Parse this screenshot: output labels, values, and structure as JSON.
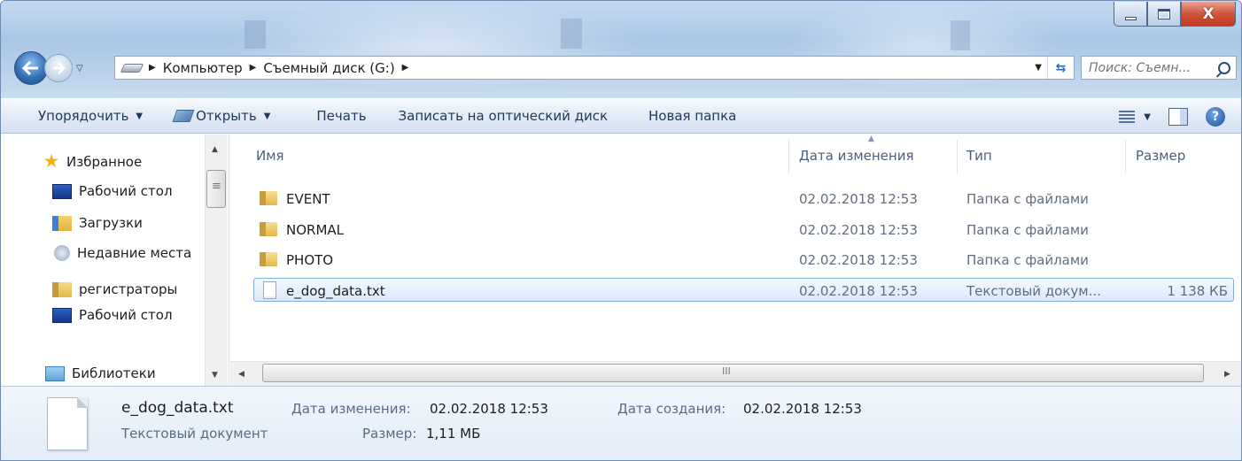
{
  "window": {
    "caption_buttons": [
      "minimize-icon",
      "maximize-icon",
      "close-icon"
    ],
    "close_glyph": "X"
  },
  "address_bar": {
    "crumbs": [
      "Компьютер",
      "Съемный диск (G:)"
    ],
    "search_placeholder": "Поиск: Съемн..."
  },
  "command_bar": {
    "organize": "Упорядочить",
    "open": "Открыть",
    "print": "Печать",
    "burn": "Записать на оптический диск",
    "new_folder": "Новая папка",
    "help_glyph": "?"
  },
  "nav_pane": {
    "favorites": "Избранное",
    "items": [
      {
        "label": "Рабочий стол",
        "icon": "desktop-icon"
      },
      {
        "label": "Загрузки",
        "icon": "downloads-icon"
      },
      {
        "label": "Недавние места",
        "icon": "recent-places-icon"
      },
      {
        "label": "регистраторы",
        "icon": "folder-icon"
      },
      {
        "label": "Рабочий стол",
        "icon": "desktop-icon"
      }
    ],
    "libraries": "Библиотеки"
  },
  "columns": {
    "name": "Имя",
    "date": "Дата изменения",
    "type": "Тип",
    "size": "Размер"
  },
  "files": [
    {
      "name": "EVENT",
      "date": "02.02.2018 12:53",
      "type": "Папка с файлами",
      "size": "",
      "kind": "folder"
    },
    {
      "name": "NORMAL",
      "date": "02.02.2018 12:53",
      "type": "Папка с файлами",
      "size": "",
      "kind": "folder"
    },
    {
      "name": "PHOTO",
      "date": "02.02.2018 12:53",
      "type": "Папка с файлами",
      "size": "",
      "kind": "folder"
    },
    {
      "name": "e_dog_data.txt",
      "date": "02.02.2018 12:53",
      "type": "Текстовый докум...",
      "size": "1 138 КБ",
      "kind": "text",
      "selected": true
    }
  ],
  "details": {
    "name": "e_dog_data.txt",
    "type": "Текстовый документ",
    "modified_label": "Дата изменения:",
    "modified_value": "02.02.2018 12:53",
    "created_label": "Дата создания:",
    "created_value": "02.02.2018 12:53",
    "size_label": "Размер:",
    "size_value": "1,11 МБ"
  }
}
